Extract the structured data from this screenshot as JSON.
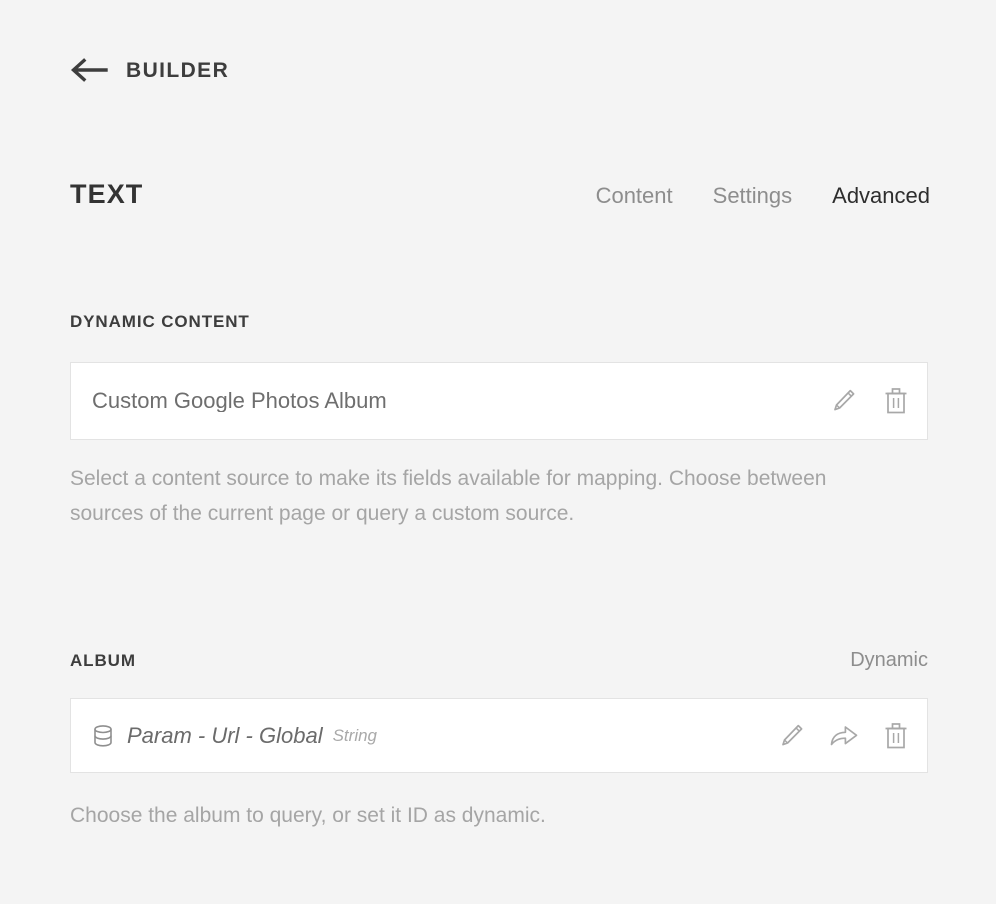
{
  "header": {
    "back_label": "BUILDER",
    "back_icon": "arrow-left-icon"
  },
  "panel": {
    "title": "TEXT",
    "tabs": [
      {
        "label": "Content",
        "active": false
      },
      {
        "label": "Settings",
        "active": false
      },
      {
        "label": "Advanced",
        "active": true
      }
    ]
  },
  "dynamic_content": {
    "section_label": "DYNAMIC CONTENT",
    "value": "Custom Google Photos Album",
    "helper": "Select a content source to make its fields available for mapping. Choose between sources of the current page or query a custom source.",
    "actions": [
      {
        "name": "edit-icon",
        "label": "Edit"
      },
      {
        "name": "trash-icon",
        "label": "Delete"
      }
    ]
  },
  "album": {
    "section_label": "ALBUM",
    "aside_label": "Dynamic",
    "source_icon": "database-icon",
    "value": "Param - Url - Global",
    "value_type": "String",
    "helper": "Choose the album to query, or set it ID as dynamic.",
    "actions": [
      {
        "name": "edit-icon",
        "label": "Edit"
      },
      {
        "name": "share-icon",
        "label": "Share"
      },
      {
        "name": "trash-icon",
        "label": "Delete"
      }
    ]
  },
  "colors": {
    "page_background": "#f4f4f4",
    "field_background": "#ffffff",
    "field_border": "#e3e3e3",
    "text_primary": "#3d3d3d",
    "text_secondary": "#6e6e6e",
    "text_muted": "#a5a5a5",
    "icon_gray": "#a8a8a8",
    "tab_active": "#2d2d2d",
    "tab_inactive": "#8d8d8d"
  }
}
